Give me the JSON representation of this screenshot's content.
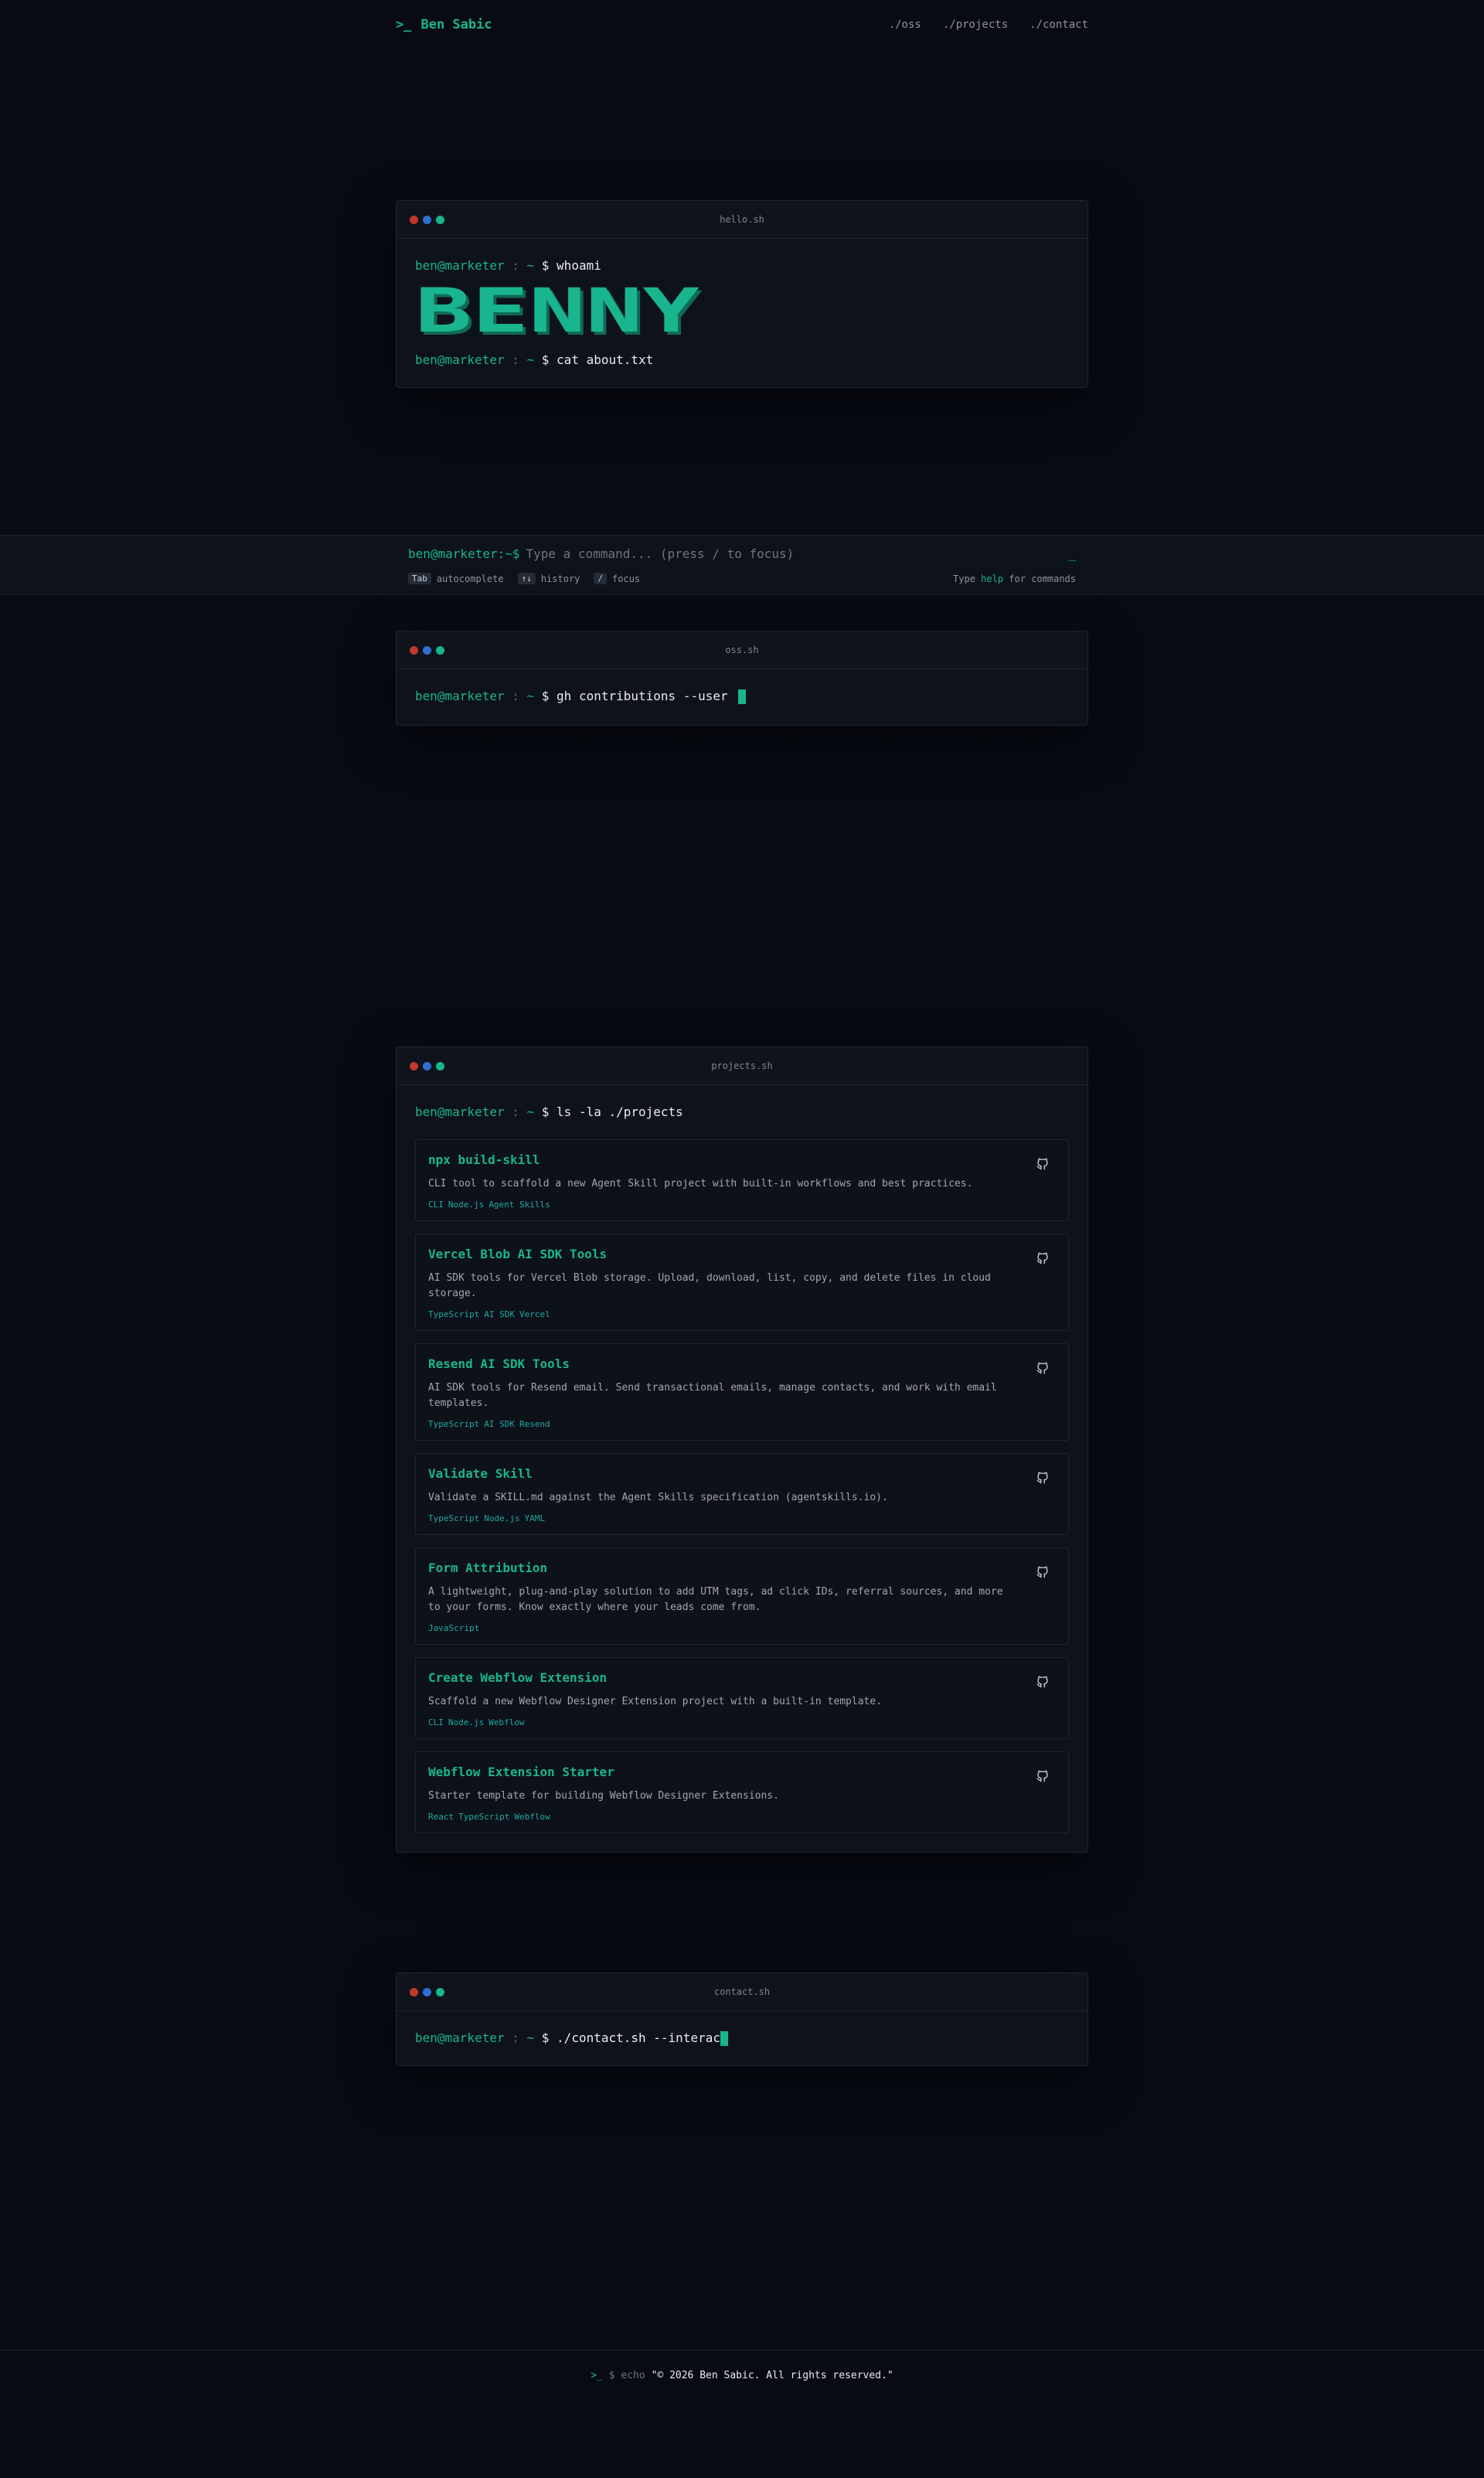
{
  "nav": {
    "brand_prompt": ">_",
    "brand_name": "Ben Sabic",
    "links": [
      "./oss",
      "./projects",
      "./contact"
    ]
  },
  "prompt": {
    "user": "ben@marketer",
    "sep": " : ",
    "tilde": "~",
    "dollar": " $ "
  },
  "hello": {
    "title": "hello.sh",
    "cmd1": "whoami",
    "ascii": "BENNY",
    "cmd2": "cat about.txt"
  },
  "cmdbar": {
    "prompt": "ben@marketer:~$",
    "placeholder": "Type a command... (press / to focus)",
    "caret": "_",
    "hints": [
      {
        "key": "Tab",
        "label": "autocomplete"
      },
      {
        "key": "↑↓",
        "label": "history"
      },
      {
        "key": "/",
        "label": "focus"
      }
    ],
    "help_pre": "Type ",
    "help_word": "help",
    "help_post": " for commands"
  },
  "oss": {
    "title": "oss.sh",
    "cmd": "gh contributions --user "
  },
  "projects": {
    "title": "projects.sh",
    "cmd": "ls -la ./projects",
    "items": [
      {
        "title": "npx build-skill",
        "desc": "CLI tool to scaffold a new Agent Skill project with built-in workflows and best practices.",
        "tags": [
          "CLI",
          "Node.js",
          "Agent Skills"
        ]
      },
      {
        "title": "Vercel Blob AI SDK Tools",
        "desc": "AI SDK tools for Vercel Blob storage. Upload, download, list, copy, and delete files in cloud storage.",
        "tags": [
          "TypeScript",
          "AI SDK",
          "Vercel"
        ]
      },
      {
        "title": "Resend AI SDK Tools",
        "desc": "AI SDK tools for Resend email. Send transactional emails, manage contacts, and work with email templates.",
        "tags": [
          "TypeScript",
          "AI SDK",
          "Resend"
        ]
      },
      {
        "title": "Validate Skill",
        "desc": "Validate a SKILL.md against the Agent Skills specification (agentskills.io).",
        "tags": [
          "TypeScript",
          "Node.js",
          "YAML"
        ]
      },
      {
        "title": "Form Attribution",
        "desc": "A lightweight, plug-and-play solution to add UTM tags, ad click IDs, referral sources, and more to your forms. Know exactly where your leads come from.",
        "tags": [
          "JavaScript"
        ]
      },
      {
        "title": "Create Webflow Extension",
        "desc": "Scaffold a new Webflow Designer Extension project with a built-in template.",
        "tags": [
          "CLI",
          "Node.js",
          "Webflow"
        ]
      },
      {
        "title": "Webflow Extension Starter",
        "desc": "Starter template for building Webflow Designer Extensions.",
        "tags": [
          "React",
          "TypeScript",
          "Webflow"
        ]
      }
    ]
  },
  "contact": {
    "title": "contact.sh",
    "cmd": "./contact.sh --interac"
  },
  "footer": {
    "prompt": ">_",
    "dollar": "$ echo",
    "text": "\"© 2026 Ben Sabic. All rights reserved.\""
  }
}
